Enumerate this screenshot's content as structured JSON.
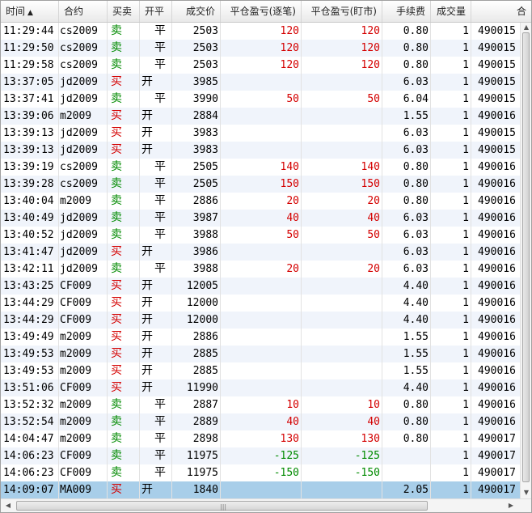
{
  "columns": {
    "time": "时间",
    "code": "合约",
    "side": "买卖",
    "open_close": "开平",
    "price": "成交价",
    "pl_trade": "平仓盈亏(逐笔)",
    "pl_mark": "平仓盈亏(盯市)",
    "fee": "手续费",
    "volume": "成交量",
    "last": "合"
  },
  "sort_icon": "sort-ascending-icon",
  "rows": [
    {
      "time": "11:29:44",
      "code": "cs2009",
      "side": "卖",
      "oc": "平",
      "price": "2503",
      "pl1": "120",
      "pl2": "120",
      "fee": "0.80",
      "vol": "1",
      "last": "490015"
    },
    {
      "time": "11:29:50",
      "code": "cs2009",
      "side": "卖",
      "oc": "平",
      "price": "2503",
      "pl1": "120",
      "pl2": "120",
      "fee": "0.80",
      "vol": "1",
      "last": "490015"
    },
    {
      "time": "11:29:58",
      "code": "cs2009",
      "side": "卖",
      "oc": "平",
      "price": "2503",
      "pl1": "120",
      "pl2": "120",
      "fee": "0.80",
      "vol": "1",
      "last": "490015"
    },
    {
      "time": "13:37:05",
      "code": "jd2009",
      "side": "买",
      "oc": "开",
      "price": "3985",
      "pl1": "",
      "pl2": "",
      "fee": "6.03",
      "vol": "1",
      "last": "490015"
    },
    {
      "time": "13:37:41",
      "code": "jd2009",
      "side": "卖",
      "oc": "平",
      "price": "3990",
      "pl1": "50",
      "pl2": "50",
      "fee": "6.04",
      "vol": "1",
      "last": "490015"
    },
    {
      "time": "13:39:06",
      "code": "m2009",
      "side": "买",
      "oc": "开",
      "price": "2884",
      "pl1": "",
      "pl2": "",
      "fee": "1.55",
      "vol": "1",
      "last": "490016"
    },
    {
      "time": "13:39:13",
      "code": "jd2009",
      "side": "买",
      "oc": "开",
      "price": "3983",
      "pl1": "",
      "pl2": "",
      "fee": "6.03",
      "vol": "1",
      "last": "490015"
    },
    {
      "time": "13:39:13",
      "code": "jd2009",
      "side": "买",
      "oc": "开",
      "price": "3983",
      "pl1": "",
      "pl2": "",
      "fee": "6.03",
      "vol": "1",
      "last": "490015"
    },
    {
      "time": "13:39:19",
      "code": "cs2009",
      "side": "卖",
      "oc": "平",
      "price": "2505",
      "pl1": "140",
      "pl2": "140",
      "fee": "0.80",
      "vol": "1",
      "last": "490016"
    },
    {
      "time": "13:39:28",
      "code": "cs2009",
      "side": "卖",
      "oc": "平",
      "price": "2505",
      "pl1": "150",
      "pl2": "150",
      "fee": "0.80",
      "vol": "1",
      "last": "490016"
    },
    {
      "time": "13:40:04",
      "code": "m2009",
      "side": "卖",
      "oc": "平",
      "price": "2886",
      "pl1": "20",
      "pl2": "20",
      "fee": "0.80",
      "vol": "1",
      "last": "490016"
    },
    {
      "time": "13:40:49",
      "code": "jd2009",
      "side": "卖",
      "oc": "平",
      "price": "3987",
      "pl1": "40",
      "pl2": "40",
      "fee": "6.03",
      "vol": "1",
      "last": "490016"
    },
    {
      "time": "13:40:52",
      "code": "jd2009",
      "side": "卖",
      "oc": "平",
      "price": "3988",
      "pl1": "50",
      "pl2": "50",
      "fee": "6.03",
      "vol": "1",
      "last": "490016"
    },
    {
      "time": "13:41:47",
      "code": "jd2009",
      "side": "买",
      "oc": "开",
      "price": "3986",
      "pl1": "",
      "pl2": "",
      "fee": "6.03",
      "vol": "1",
      "last": "490016"
    },
    {
      "time": "13:42:11",
      "code": "jd2009",
      "side": "卖",
      "oc": "平",
      "price": "3988",
      "pl1": "20",
      "pl2": "20",
      "fee": "6.03",
      "vol": "1",
      "last": "490016"
    },
    {
      "time": "13:43:25",
      "code": "CF009",
      "side": "买",
      "oc": "开",
      "price": "12005",
      "pl1": "",
      "pl2": "",
      "fee": "4.40",
      "vol": "1",
      "last": "490016"
    },
    {
      "time": "13:44:29",
      "code": "CF009",
      "side": "买",
      "oc": "开",
      "price": "12000",
      "pl1": "",
      "pl2": "",
      "fee": "4.40",
      "vol": "1",
      "last": "490016"
    },
    {
      "time": "13:44:29",
      "code": "CF009",
      "side": "买",
      "oc": "开",
      "price": "12000",
      "pl1": "",
      "pl2": "",
      "fee": "4.40",
      "vol": "1",
      "last": "490016"
    },
    {
      "time": "13:49:49",
      "code": "m2009",
      "side": "买",
      "oc": "开",
      "price": "2886",
      "pl1": "",
      "pl2": "",
      "fee": "1.55",
      "vol": "1",
      "last": "490016"
    },
    {
      "time": "13:49:53",
      "code": "m2009",
      "side": "买",
      "oc": "开",
      "price": "2885",
      "pl1": "",
      "pl2": "",
      "fee": "1.55",
      "vol": "1",
      "last": "490016"
    },
    {
      "time": "13:49:53",
      "code": "m2009",
      "side": "买",
      "oc": "开",
      "price": "2885",
      "pl1": "",
      "pl2": "",
      "fee": "1.55",
      "vol": "1",
      "last": "490016"
    },
    {
      "time": "13:51:06",
      "code": "CF009",
      "side": "买",
      "oc": "开",
      "price": "11990",
      "pl1": "",
      "pl2": "",
      "fee": "4.40",
      "vol": "1",
      "last": "490016"
    },
    {
      "time": "13:52:32",
      "code": "m2009",
      "side": "卖",
      "oc": "平",
      "price": "2887",
      "pl1": "10",
      "pl2": "10",
      "fee": "0.80",
      "vol": "1",
      "last": "490016"
    },
    {
      "time": "13:52:54",
      "code": "m2009",
      "side": "卖",
      "oc": "平",
      "price": "2889",
      "pl1": "40",
      "pl2": "40",
      "fee": "0.80",
      "vol": "1",
      "last": "490016"
    },
    {
      "time": "14:04:47",
      "code": "m2009",
      "side": "卖",
      "oc": "平",
      "price": "2898",
      "pl1": "130",
      "pl2": "130",
      "fee": "0.80",
      "vol": "1",
      "last": "490017"
    },
    {
      "time": "14:06:23",
      "code": "CF009",
      "side": "卖",
      "oc": "平",
      "price": "11975",
      "pl1": "-125",
      "pl2": "-125",
      "fee": "",
      "vol": "1",
      "last": "490017"
    },
    {
      "time": "14:06:23",
      "code": "CF009",
      "side": "卖",
      "oc": "平",
      "price": "11975",
      "pl1": "-150",
      "pl2": "-150",
      "fee": "",
      "vol": "1",
      "last": "490017"
    },
    {
      "time": "14:09:07",
      "code": "MA009",
      "side": "买",
      "oc": "开",
      "price": "1840",
      "pl1": "",
      "pl2": "",
      "fee": "2.05",
      "vol": "1",
      "last": "490017"
    }
  ],
  "selected_row_index": 27,
  "colors": {
    "buy": "#d40000",
    "sell": "#008a00",
    "selected_row": "#a8cee9",
    "alt_row": "#f0f4fb"
  },
  "scroll_icons": {
    "up": "scroll-up-arrow-icon",
    "down": "scroll-down-arrow-icon",
    "left": "scroll-left-arrow-icon",
    "right": "scroll-right-arrow-icon"
  }
}
